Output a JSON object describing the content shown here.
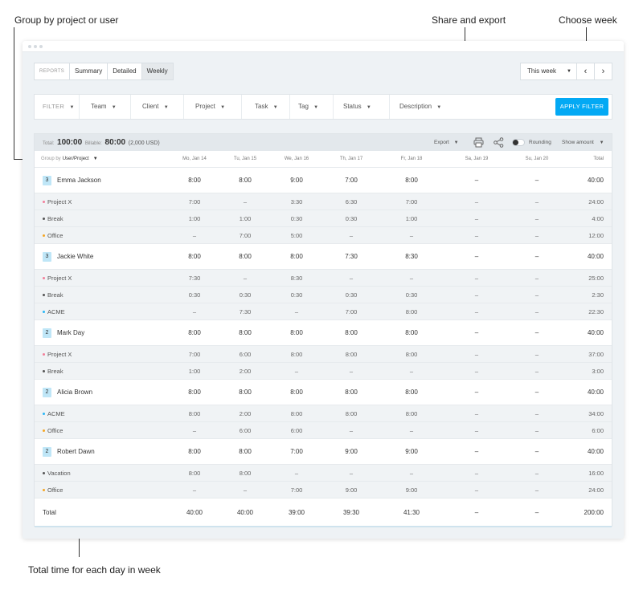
{
  "annotations": {
    "group_by": "Group by project or user",
    "share_export": "Share and export",
    "choose_week": "Choose week",
    "total_time": "Total time for each day in week"
  },
  "tabs": {
    "reports": "REPORTS",
    "summary": "Summary",
    "detailed": "Detailed",
    "weekly": "Weekly",
    "active": "weekly"
  },
  "week": {
    "label": "This week",
    "prev": "‹",
    "next": "›"
  },
  "filters": {
    "filter": "FILTER",
    "team": "Team",
    "client": "Client",
    "project": "Project",
    "task": "Task",
    "tag": "Tag",
    "status": "Status",
    "description": "Description",
    "apply": "APPLY FILTER"
  },
  "summary": {
    "total_label": "Total:",
    "total_value": "100:00",
    "billable_label": "Billable:",
    "billable_value": "80:00",
    "billable_amount": "(2,000 USD)",
    "export": "Export",
    "rounding": "Rounding",
    "show_amount": "Show amount"
  },
  "table": {
    "group_by_label": "Group by",
    "group_by_value": "User/Project",
    "days": [
      "Mo, Jan 14",
      "Tu, Jan 15",
      "We, Jan 16",
      "Th, Jan 17",
      "Fr, Jan 18",
      "Sa, Jan 19",
      "Su, Jan 20"
    ],
    "total_header": "Total",
    "groups": [
      {
        "badge": "3",
        "name": "Emma Jackson",
        "values": [
          "8:00",
          "8:00",
          "9:00",
          "7:00",
          "8:00",
          "–",
          "–"
        ],
        "total": "40:00",
        "projects": [
          {
            "name": "Project X",
            "color": "#f27f9a",
            "values": [
              "7:00",
              "–",
              "3:30",
              "6:30",
              "7:00",
              "–",
              "–"
            ],
            "total": "24:00"
          },
          {
            "name": "Break",
            "color": "#555555",
            "values": [
              "1:00",
              "1:00",
              "0:30",
              "0:30",
              "1:00",
              "–",
              "–"
            ],
            "total": "4:00"
          },
          {
            "name": "Office",
            "color": "#f5a623",
            "values": [
              "–",
              "7:00",
              "5:00",
              "–",
              "–",
              "–",
              "–"
            ],
            "total": "12:00"
          }
        ]
      },
      {
        "badge": "3",
        "name": "Jackie White",
        "values": [
          "8:00",
          "8:00",
          "8:00",
          "7:30",
          "8:30",
          "–",
          "–"
        ],
        "total": "40:00",
        "projects": [
          {
            "name": "Project X",
            "color": "#f27f9a",
            "values": [
              "7:30",
              "–",
              "8:30",
              "–",
              "–",
              "–",
              "–"
            ],
            "total": "25:00"
          },
          {
            "name": "Break",
            "color": "#555555",
            "values": [
              "0:30",
              "0:30",
              "0:30",
              "0:30",
              "0:30",
              "–",
              "–"
            ],
            "total": "2:30"
          },
          {
            "name": "ACME",
            "color": "#29b6f6",
            "values": [
              "–",
              "7:30",
              "–",
              "7:00",
              "8:00",
              "–",
              "–"
            ],
            "total": "22:30"
          }
        ]
      },
      {
        "badge": "2",
        "name": "Mark Day",
        "values": [
          "8:00",
          "8:00",
          "8:00",
          "8:00",
          "8:00",
          "–",
          "–"
        ],
        "total": "40:00",
        "projects": [
          {
            "name": "Project X",
            "color": "#f27f9a",
            "values": [
              "7:00",
              "6:00",
              "8:00",
              "8:00",
              "8:00",
              "–",
              "–"
            ],
            "total": "37:00"
          },
          {
            "name": "Break",
            "color": "#555555",
            "values": [
              "1:00",
              "2:00",
              "–",
              "–",
              "–",
              "–",
              "–"
            ],
            "total": "3:00"
          }
        ]
      },
      {
        "badge": "2",
        "name": "Alicia Brown",
        "values": [
          "8:00",
          "8:00",
          "8:00",
          "8:00",
          "8:00",
          "–",
          "–"
        ],
        "total": "40:00",
        "projects": [
          {
            "name": "ACME",
            "color": "#29b6f6",
            "values": [
              "8:00",
              "2:00",
              "8:00",
              "8:00",
              "8:00",
              "–",
              "–"
            ],
            "total": "34:00"
          },
          {
            "name": "Office",
            "color": "#f5a623",
            "values": [
              "–",
              "6:00",
              "6:00",
              "–",
              "–",
              "–",
              "–"
            ],
            "total": "6:00"
          }
        ]
      },
      {
        "badge": "2",
        "name": "Robert Dawn",
        "values": [
          "8:00",
          "8:00",
          "7:00",
          "9:00",
          "9:00",
          "–",
          "–"
        ],
        "total": "40:00",
        "projects": [
          {
            "name": "Vacation",
            "color": "#555555",
            "values": [
              "8:00",
              "8:00",
              "–",
              "–",
              "–",
              "–",
              "–"
            ],
            "total": "16:00"
          },
          {
            "name": "Office",
            "color": "#f5a623",
            "values": [
              "–",
              "–",
              "7:00",
              "9:00",
              "9:00",
              "–",
              "–"
            ],
            "total": "24:00"
          }
        ]
      }
    ],
    "total_row": {
      "label": "Total",
      "values": [
        "40:00",
        "40:00",
        "39:00",
        "39:30",
        "41:30",
        "–",
        "–"
      ],
      "total": "200:00"
    }
  }
}
